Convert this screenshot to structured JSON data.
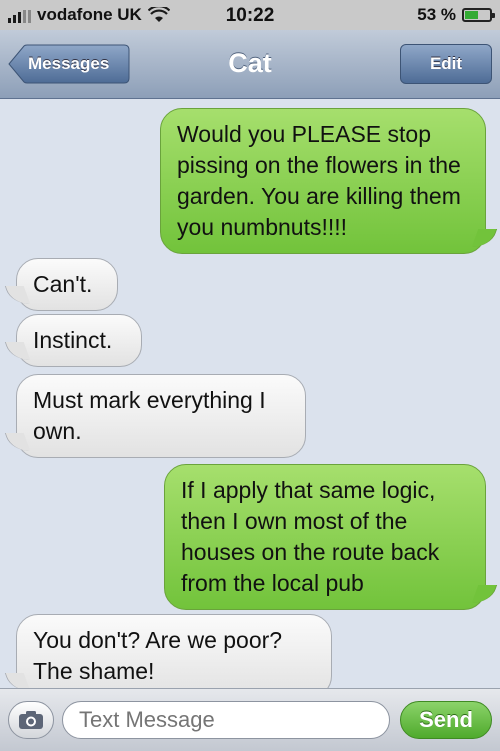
{
  "status_bar": {
    "carrier": "vodafone UK",
    "time": "10:22",
    "battery": "53 %",
    "battery_level": 0.53
  },
  "nav": {
    "back_label": "Messages",
    "title": "Cat",
    "edit_label": "Edit"
  },
  "messages": [
    {
      "side": "out",
      "text": "Would you PLEASE stop pissing on the flowers in the garden. You are killing them you numbnuts!!!!"
    },
    {
      "side": "in",
      "text": "Can't."
    },
    {
      "side": "in",
      "text": "Instinct."
    },
    {
      "side": "in",
      "text": "Must mark everything I own."
    },
    {
      "side": "out",
      "text": "If I apply that same logic, then I own most of the houses on the route back from the local pub"
    },
    {
      "side": "in",
      "text": "You don't? Are we poor? The shame!"
    }
  ],
  "composer": {
    "placeholder": "Text Message",
    "send_label": "Send"
  },
  "colors": {
    "outgoing_bubble": "#72c33b",
    "incoming_bubble": "#e2e2e2",
    "background": "#dbe2ed"
  }
}
